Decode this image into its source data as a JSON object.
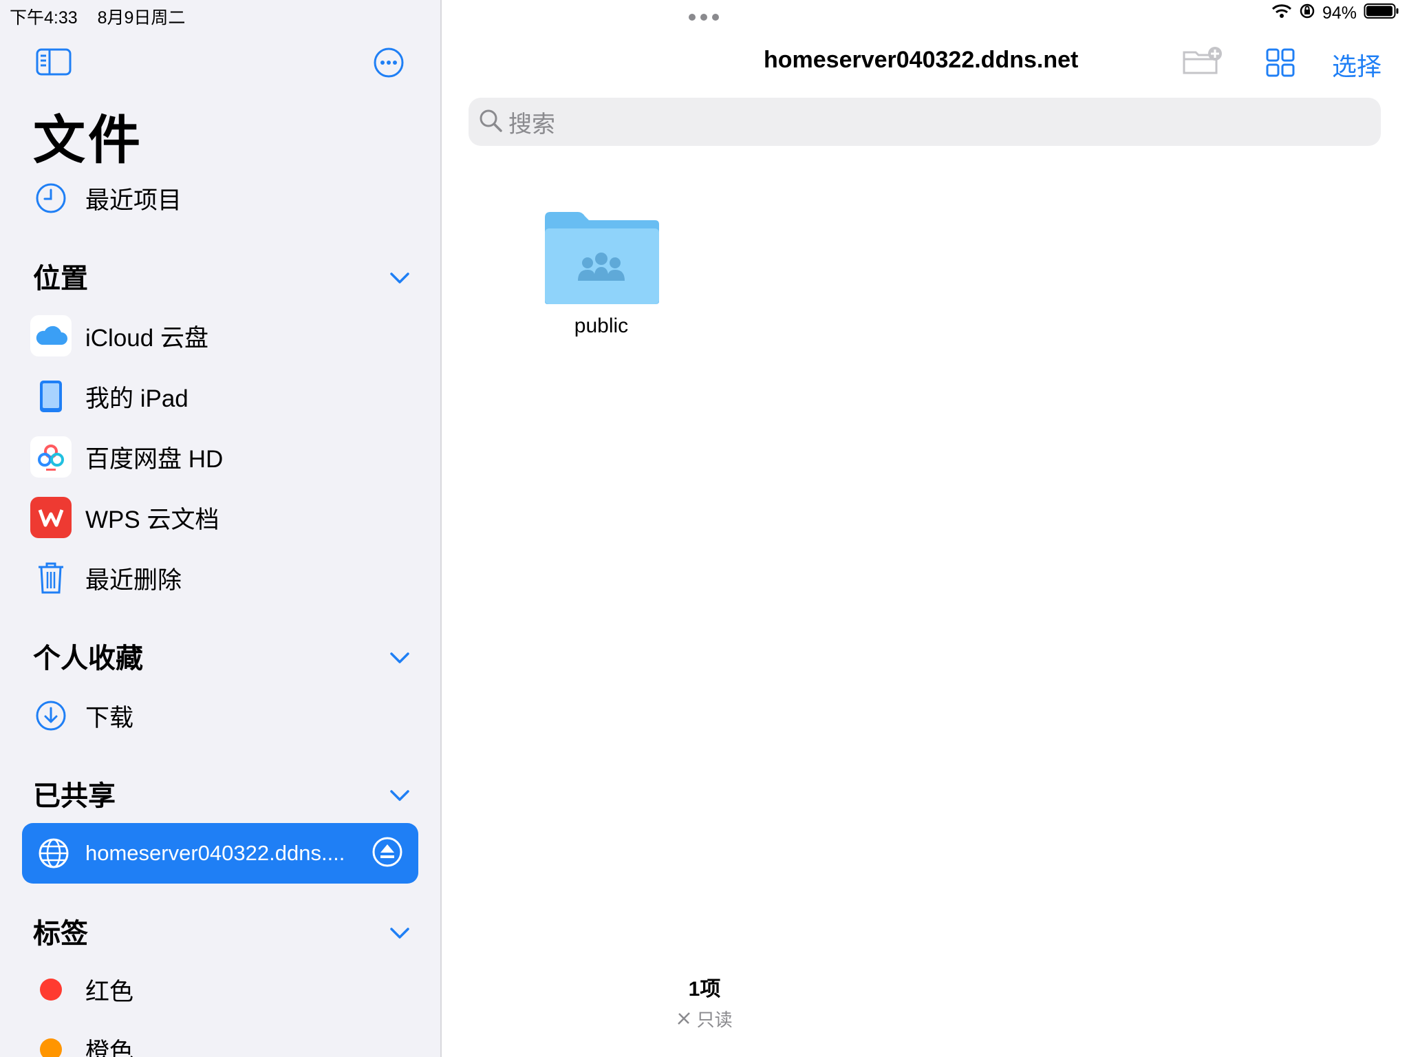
{
  "status": {
    "time": "下午4:33",
    "date": "8月9日周二",
    "battery": "94%"
  },
  "sidebar": {
    "title": "文件",
    "recents_label": "最近项目",
    "locations": {
      "header": "位置",
      "items": [
        {
          "label": "iCloud 云盘",
          "icon": "icloud-icon"
        },
        {
          "label": "我的 iPad",
          "icon": "ipad-icon"
        },
        {
          "label": "百度网盘 HD",
          "icon": "baidu-netdisk-icon"
        },
        {
          "label": "WPS 云文档",
          "icon": "wps-icon"
        },
        {
          "label": "最近删除",
          "icon": "trash-icon"
        }
      ]
    },
    "favorites": {
      "header": "个人收藏",
      "items": [
        {
          "label": "下载",
          "icon": "download-icon"
        }
      ]
    },
    "shared": {
      "header": "已共享",
      "items": [
        {
          "label": "homeserver040322.ddns....",
          "icon": "globe-icon"
        }
      ]
    },
    "tags": {
      "header": "标签",
      "items": [
        {
          "label": "红色",
          "color": "#ff3b30"
        },
        {
          "label": "橙色",
          "color": "#ff9500"
        }
      ]
    }
  },
  "main": {
    "title": "homeserver040322.ddns.net",
    "select_label": "选择",
    "search_placeholder": "搜索",
    "items": [
      {
        "name": "public",
        "icon": "shared-folder-icon"
      }
    ],
    "footer_count": "1项",
    "footer_status": "只读"
  },
  "colors": {
    "accent": "#1f7ff5",
    "sidebar_bg": "#f2f2f7",
    "folder": "#7ccaf7"
  }
}
